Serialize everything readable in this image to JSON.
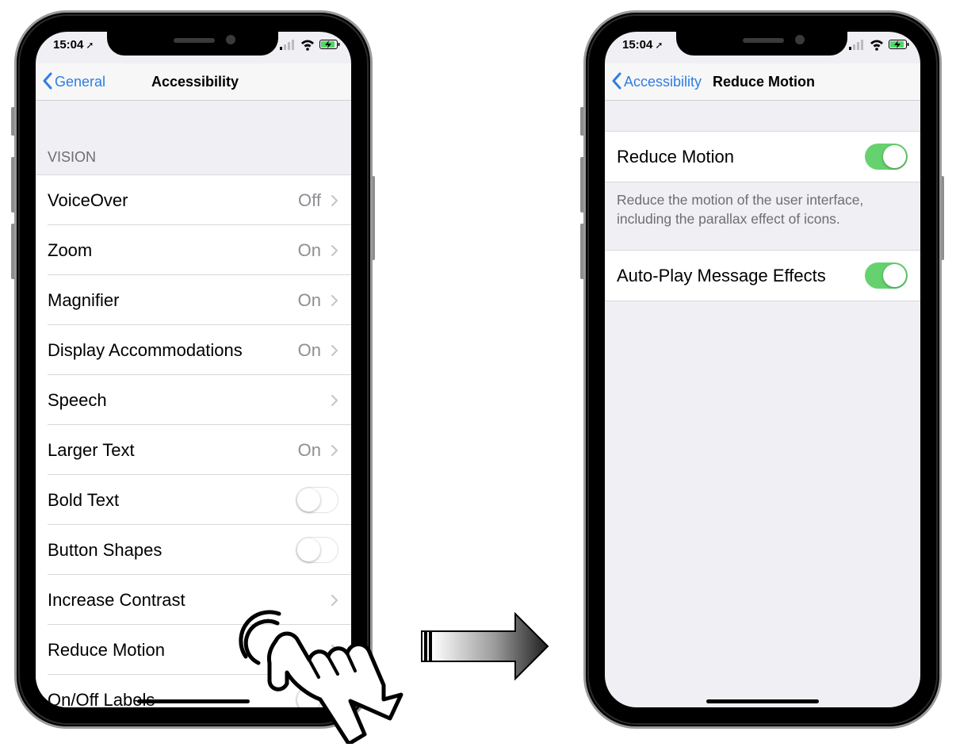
{
  "status_bar": {
    "time": "15:04"
  },
  "left_screen": {
    "back_label": "General",
    "title": "Accessibility",
    "section_header": "VISION",
    "rows": [
      {
        "label": "VoiceOver",
        "value": "Off",
        "kind": "disclosure"
      },
      {
        "label": "Zoom",
        "value": "On",
        "kind": "disclosure"
      },
      {
        "label": "Magnifier",
        "value": "On",
        "kind": "disclosure"
      },
      {
        "label": "Display Accommodations",
        "value": "On",
        "kind": "disclosure"
      },
      {
        "label": "Speech",
        "value": "",
        "kind": "disclosure"
      },
      {
        "label": "Larger Text",
        "value": "On",
        "kind": "disclosure"
      },
      {
        "label": "Bold Text",
        "value": "",
        "kind": "toggle",
        "on": false
      },
      {
        "label": "Button Shapes",
        "value": "",
        "kind": "toggle",
        "on": false
      },
      {
        "label": "Increase Contrast",
        "value": "",
        "kind": "disclosure"
      },
      {
        "label": "Reduce Motion",
        "value": "",
        "kind": "disclosure"
      },
      {
        "label": "On/Off Labels",
        "value": "",
        "kind": "toggle",
        "on": false
      }
    ]
  },
  "right_screen": {
    "back_label": "Accessibility",
    "title": "Reduce Motion",
    "reduce_motion": {
      "label": "Reduce Motion",
      "on": true
    },
    "reduce_motion_footer": "Reduce the motion of the user interface, including the parallax effect of icons.",
    "auto_play": {
      "label": "Auto-Play Message Effects",
      "on": true
    }
  },
  "colors": {
    "accent": "#2f7de1",
    "toggle_on": "#65d26f",
    "group_background": "#efeff4",
    "secondary_text": "#8e8e93"
  },
  "icons": [
    "location-arrow-icon",
    "cellular-signal-icon",
    "wifi-icon",
    "battery-charging-icon",
    "chevron-left-icon",
    "chevron-right-icon",
    "tap-hand-icon",
    "transition-arrow-icon"
  ]
}
